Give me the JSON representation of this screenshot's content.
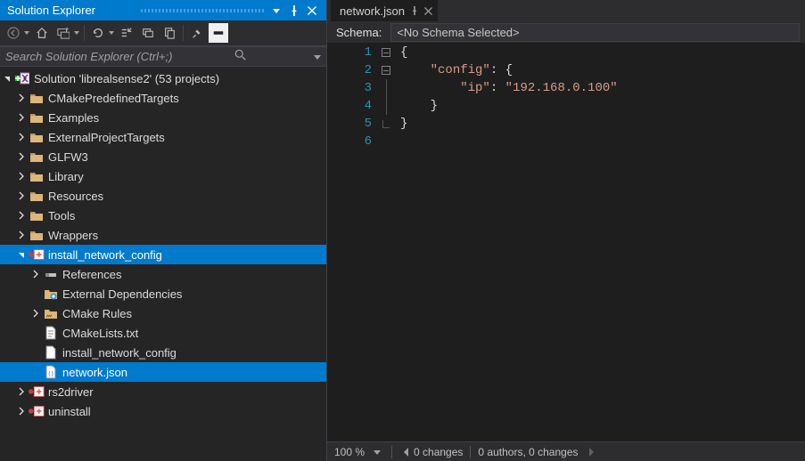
{
  "panel": {
    "title": "Solution Explorer",
    "search_placeholder": "Search Solution Explorer (Ctrl+;)"
  },
  "solution": {
    "label": "Solution 'librealsense2' (53 projects)"
  },
  "folders": [
    "CMakePredefinedTargets",
    "Examples",
    "ExternalProjectTargets",
    "GLFW3",
    "Library",
    "Resources",
    "Tools",
    "Wrappers"
  ],
  "proj": {
    "name": "install_network_config",
    "refs": "References",
    "ext": "External Dependencies",
    "cmrules": "CMake Rules",
    "cmlists": "CMakeLists.txt",
    "binfile": "install_network_config",
    "json": "network.json"
  },
  "otherProjects": [
    "rs2driver",
    "uninstall"
  ],
  "editor": {
    "tabName": "network.json",
    "schema_label": "Schema:",
    "schema_value": "<No Schema Selected>",
    "zoom": "100 %",
    "changes": "0 changes",
    "authors": "0 authors, 0 changes",
    "lines": {
      "1": "{",
      "2key": "\"config\"",
      "2rest": ": {",
      "3key": "\"ip\"",
      "3mid": ": ",
      "3val": "\"192.168.0.100\"",
      "4": "    }",
      "5": "}"
    }
  }
}
